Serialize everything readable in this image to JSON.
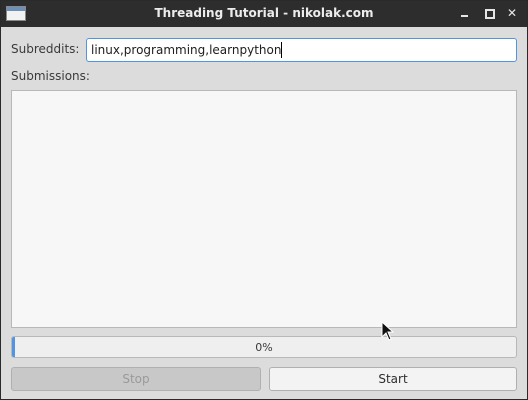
{
  "window": {
    "title": "Threading Tutorial - nikolak.com"
  },
  "form": {
    "subreddits_label": "Subreddits:",
    "subreddits_value": "linux,programming,learnpython",
    "submissions_label": "Submissions:"
  },
  "progress": {
    "value": 0,
    "text": "0%"
  },
  "buttons": {
    "stop_label": "Stop",
    "start_label": "Start"
  },
  "colors": {
    "accent": "#5294e2",
    "titlebar": "#2d2d2d",
    "window_bg": "#dcdcdc"
  },
  "icons": {
    "app": "app-window-icon",
    "minimize": "minimize-icon",
    "maximize": "maximize-icon",
    "close": "close-icon",
    "pointer": "mouse-pointer-icon"
  }
}
